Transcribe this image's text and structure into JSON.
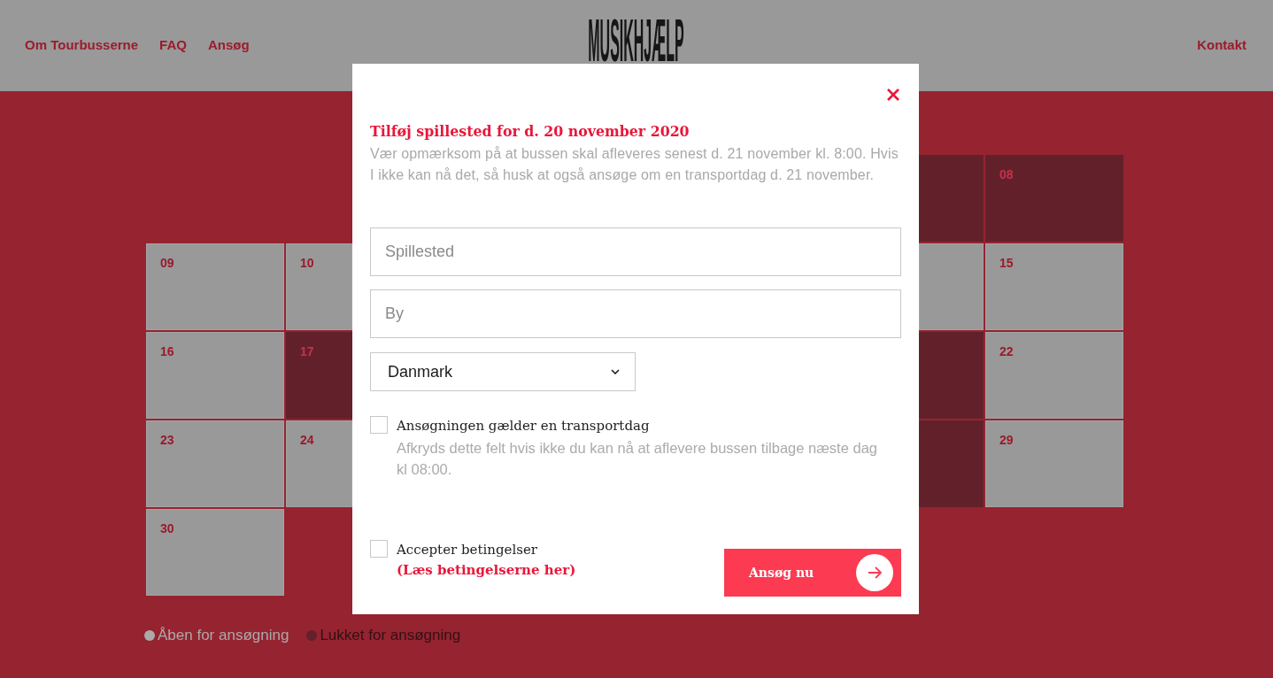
{
  "header": {
    "nav_left": [
      "Om Tourbusserne",
      "FAQ",
      "Ansøg"
    ],
    "logo": "MUSIKHJÆLP",
    "nav_right": [
      "Kontakt"
    ]
  },
  "calendar": {
    "weeks": [
      {
        "cells": [
          {
            "kind": "blank"
          },
          {
            "kind": "blank"
          },
          {
            "kind": "day",
            "open": false
          },
          {
            "kind": "day",
            "day": "08",
            "open": false
          }
        ]
      },
      {
        "cells": [
          {
            "kind": "day",
            "day": "09",
            "open": true
          },
          {
            "kind": "day",
            "day": "10",
            "open": true
          },
          {
            "kind": "day",
            "open": true
          },
          {
            "kind": "day",
            "day": "15",
            "open": true
          }
        ]
      },
      {
        "cells": [
          {
            "kind": "day",
            "day": "16",
            "open": true
          },
          {
            "kind": "day",
            "day": "17",
            "open": false
          },
          {
            "kind": "day",
            "open": false
          },
          {
            "kind": "day",
            "day": "22",
            "open": true
          }
        ]
      },
      {
        "cells": [
          {
            "kind": "day",
            "day": "23",
            "open": true
          },
          {
            "kind": "day",
            "day": "24",
            "open": true
          },
          {
            "kind": "day",
            "open": false
          },
          {
            "kind": "day",
            "day": "29",
            "open": true
          }
        ]
      },
      {
        "cells": [
          {
            "kind": "day",
            "day": "30",
            "open": true
          },
          {
            "kind": "blank"
          },
          {
            "kind": "blank"
          },
          {
            "kind": "blank"
          }
        ]
      }
    ]
  },
  "legend": [
    {
      "label": "Åben for ansøgning",
      "color": "#aaaaaa"
    },
    {
      "label": "Lukket for ansøgning",
      "color": "#62212a"
    }
  ],
  "modal": {
    "title": "Tilføj spillested for d. 20 november 2020",
    "note": "Vær opmærksom på at bussen skal afleveres senest d. 21 november kl. 8:00. Hvis I ikke kan nå det, så husk at også ansøge om en transportdag d. 21 november.",
    "fields": [
      {
        "placeholder": "Spillested"
      },
      {
        "placeholder": "By"
      }
    ],
    "country_select": {
      "value": "Danmark"
    },
    "transport_day": {
      "label": "Ansøgningen gælder en transportdag",
      "checked": false,
      "help": "Afkryds dette felt hvis ikke du kan nå at aflevere bussen tilbage næste dag kl 08:00."
    },
    "terms": {
      "label": "Accepter betingelser",
      "checked": false,
      "link": "(Læs betingelserne her)"
    },
    "submit": {
      "label": "Ansøg nu"
    }
  }
}
